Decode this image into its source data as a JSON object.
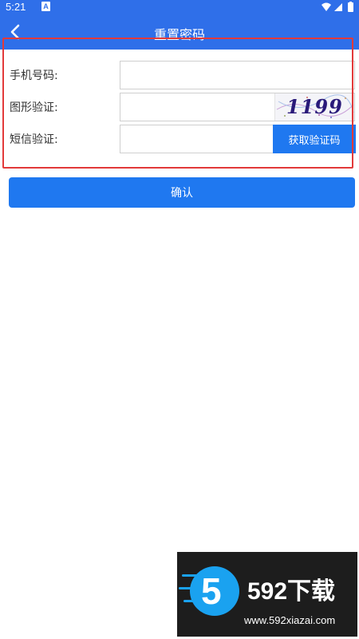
{
  "status_bar": {
    "time": "5:21",
    "notification_icon": "A",
    "icons": [
      "wifi-icon",
      "signal-icon",
      "battery-icon"
    ]
  },
  "app_bar": {
    "title": "重置密码",
    "back_icon": "chevron-left-icon"
  },
  "form": {
    "phone": {
      "label": "手机号码:",
      "value": "",
      "placeholder": ""
    },
    "captcha": {
      "label": "图形验证:",
      "value": "",
      "placeholder": "",
      "image_text": "1199"
    },
    "sms": {
      "label": "短信验证:",
      "value": "",
      "placeholder": "",
      "button_label": "获取验证码"
    }
  },
  "confirm_button": {
    "label": "确认"
  },
  "watermark": {
    "logo_digit": "5",
    "brand": "592下载",
    "url": "www.592xiazai.com"
  },
  "colors": {
    "primary": "#2f6fe9",
    "button": "#1f78f0",
    "highlight_border": "#e23a3a",
    "watermark_bg": "#1d1d1d",
    "watermark_accent": "#1aa2f0"
  }
}
